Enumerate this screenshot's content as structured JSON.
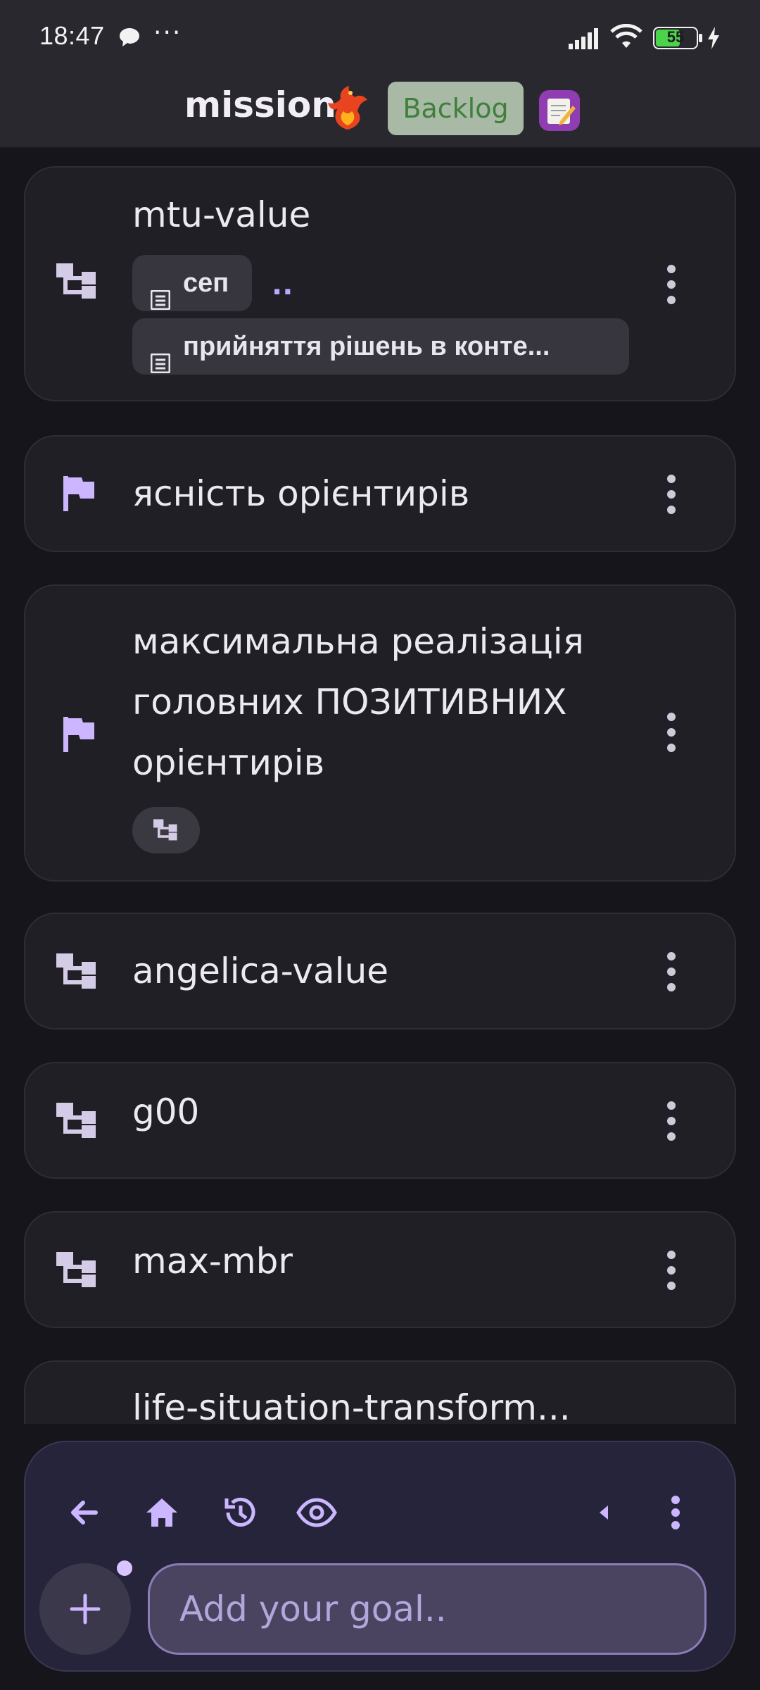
{
  "status_bar": {
    "time": "18:47",
    "more": "···",
    "battery": "55",
    "icons": [
      "chat-bubble-icon",
      "signal-icon",
      "wifi-icon",
      "battery-icon",
      "charging-bolt-icon"
    ]
  },
  "header": {
    "title": "mission",
    "title_emoji_icon": "phoenix-icon",
    "backlog_label": "Backlog",
    "notes_icon": "notes-icon",
    "colors": {
      "backlog_bg": "#a8b9a6",
      "backlog_text": "#3f7f3a",
      "notes_bg": "#8f3db0"
    }
  },
  "goals": [
    {
      "title": "mtu-value",
      "icon": "hierarchy-icon",
      "tags": [
        "сеп",
        "прийняття рішень в конте..."
      ],
      "extra": ".."
    },
    {
      "title": "ясність орієнтирів",
      "icon": "flag-icon"
    },
    {
      "title": "максимальна реалізація головних ПОЗИТИВНИХ орієнтирів",
      "icon": "flag-icon",
      "sub_icon": "hierarchy-icon"
    },
    {
      "title": "angelica-value",
      "icon": "hierarchy-icon"
    },
    {
      "title": "g00",
      "icon": "hierarchy-icon"
    },
    {
      "title": "max-mbr",
      "icon": "hierarchy-icon"
    },
    {
      "title": "life-situation-transform...",
      "icon": "hierarchy-icon"
    }
  ],
  "toolbar": {
    "icons": [
      "back-arrow-icon",
      "home-icon",
      "history-icon",
      "eye-icon",
      "collapse-left-icon",
      "more-vertical-icon"
    ]
  },
  "input": {
    "placeholder": "Add your goal..",
    "add_icon": "plus-icon"
  },
  "colors": {
    "accent": "#cbb6ff",
    "card_bg": "#201f25",
    "page_bg": "#16151b",
    "panel_bg": "#26243a"
  }
}
